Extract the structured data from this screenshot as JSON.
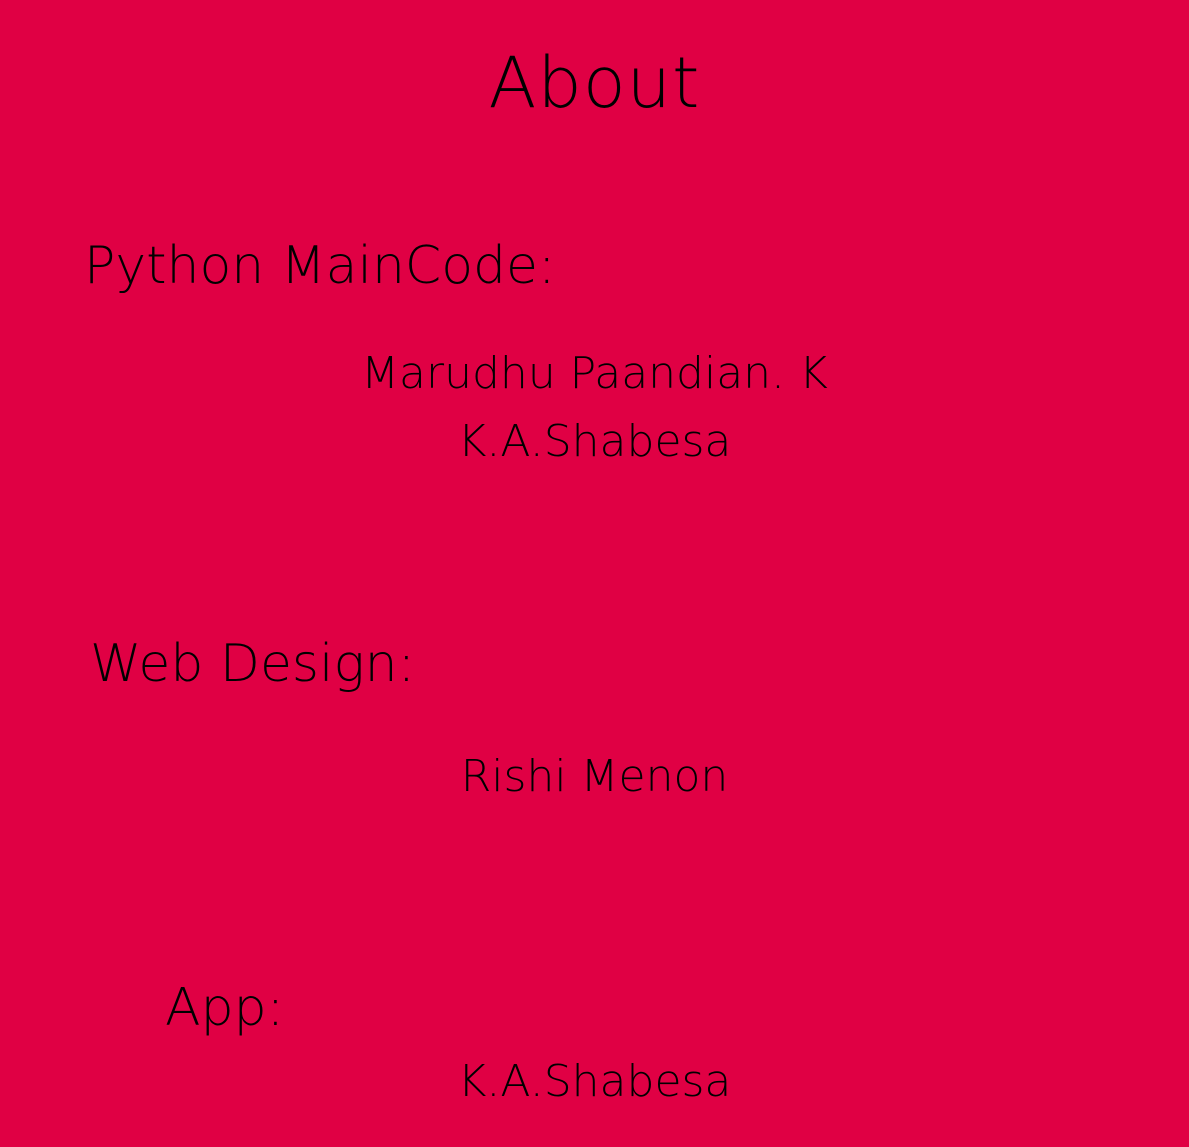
{
  "page": {
    "title": "About",
    "background_color": "#E00044",
    "text_color": "#000000"
  },
  "sections": [
    {
      "heading": "Python MainCode:",
      "names": [
        "Marudhu Paandian. K",
        "K.A.Shabesa"
      ]
    },
    {
      "heading": "Web Design:",
      "names": [
        "Rishi Menon"
      ]
    },
    {
      "heading": "App:",
      "names": [
        "K.A.Shabesa"
      ]
    }
  ]
}
